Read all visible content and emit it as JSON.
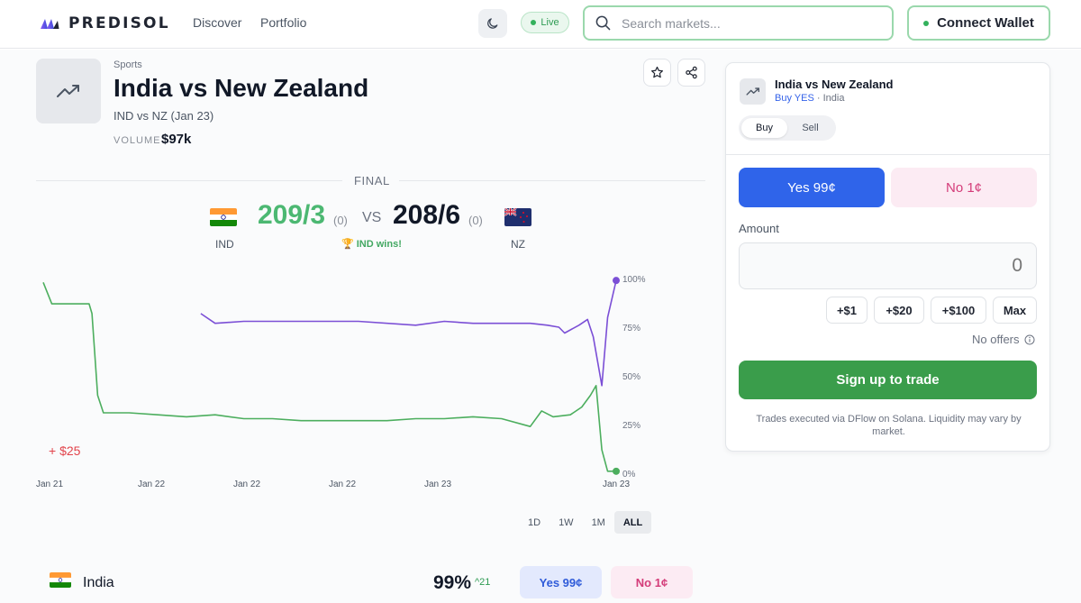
{
  "nav": {
    "brand": "PREDISOL",
    "links": [
      "Discover",
      "Portfolio"
    ],
    "live_label": "Live",
    "search_placeholder": "Search markets...",
    "wallet_label": "Connect Wallet"
  },
  "market": {
    "category": "Sports",
    "title": "India vs New Zealand",
    "subtitle": "IND vs NZ (Jan 23)",
    "volume_label": "VOLUME",
    "volume_value": "$97k"
  },
  "scoreboard": {
    "status": "FINAL",
    "home": {
      "code": "IND",
      "score": "209/3",
      "extra": "(0)"
    },
    "away": {
      "code": "NZ",
      "score": "208/6",
      "extra": "(0)"
    },
    "vs": "VS",
    "result": "🏆 IND wins!"
  },
  "chart_data": {
    "type": "line",
    "x": [
      "Jan 21",
      "Jan 22",
      "Jan 22",
      "Jan 22",
      "Jan 23",
      "Jan 23"
    ],
    "yticks": [
      "100%",
      "75%",
      "50%",
      "25%",
      "0%"
    ],
    "ylim": [
      0,
      100
    ],
    "series": [
      {
        "color": "#7b4fd6",
        "points": [
          [
            0.275,
            82
          ],
          [
            0.3,
            77
          ],
          [
            0.35,
            78
          ],
          [
            0.45,
            78
          ],
          [
            0.55,
            78
          ],
          [
            0.65,
            76
          ],
          [
            0.7,
            78
          ],
          [
            0.75,
            77
          ],
          [
            0.8,
            77
          ],
          [
            0.85,
            77
          ],
          [
            0.88,
            76
          ],
          [
            0.9,
            75
          ],
          [
            0.91,
            72
          ],
          [
            0.935,
            76
          ],
          [
            0.95,
            79
          ],
          [
            0.96,
            70
          ],
          [
            0.975,
            45
          ],
          [
            0.985,
            80
          ],
          [
            1.0,
            99
          ]
        ]
      },
      {
        "color": "#4cae5e",
        "points": [
          [
            0.0,
            98
          ],
          [
            0.015,
            87
          ],
          [
            0.08,
            87
          ],
          [
            0.085,
            82
          ],
          [
            0.095,
            40
          ],
          [
            0.105,
            31
          ],
          [
            0.15,
            31
          ],
          [
            0.2,
            30
          ],
          [
            0.25,
            29
          ],
          [
            0.3,
            30
          ],
          [
            0.35,
            28
          ],
          [
            0.4,
            28
          ],
          [
            0.45,
            27
          ],
          [
            0.5,
            27
          ],
          [
            0.55,
            27
          ],
          [
            0.6,
            27
          ],
          [
            0.65,
            28
          ],
          [
            0.7,
            28
          ],
          [
            0.75,
            29
          ],
          [
            0.8,
            28
          ],
          [
            0.85,
            24
          ],
          [
            0.87,
            32
          ],
          [
            0.89,
            29
          ],
          [
            0.92,
            30
          ],
          [
            0.94,
            34
          ],
          [
            0.955,
            40
          ],
          [
            0.965,
            45
          ],
          [
            0.975,
            12
          ],
          [
            0.985,
            1
          ],
          [
            1.0,
            1
          ]
        ]
      }
    ],
    "pnl_label": "+ $25"
  },
  "ranges": [
    "1D",
    "1W",
    "1M",
    "ALL"
  ],
  "active_range": "ALL",
  "outcome": {
    "name": "India",
    "pct": "99%",
    "change": "21",
    "yes_label": "Yes 99¢",
    "no_label": "No 1¢"
  },
  "panel": {
    "title": "India vs New Zealand",
    "sub_highlight": "Buy YES",
    "sub_rest": " · India",
    "buy_label": "Buy",
    "sell_label": "Sell",
    "yes_label": "Yes 99¢",
    "no_label": "No 1¢",
    "amount_label": "Amount",
    "amount_value": "0",
    "quick": [
      "+$1",
      "+$20",
      "+$100",
      "Max"
    ],
    "offers_label": "No offers",
    "signup_label": "Sign up to trade",
    "disclaimer": "Trades executed via DFlow on Solana. Liquidity may vary by market."
  },
  "colors": {
    "accent_green": "#3a9d4b",
    "yes_blue": "#2f64ea",
    "no_pink": "#d43c79",
    "purple_line": "#7b4fd6"
  }
}
